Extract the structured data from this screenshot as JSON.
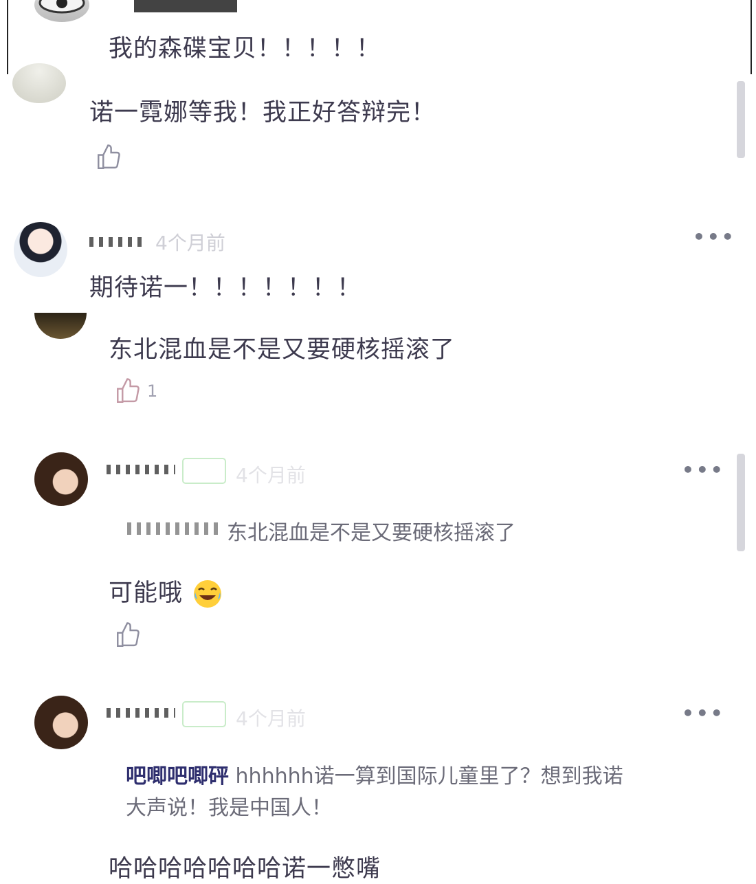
{
  "comments": [
    {
      "text": "我的森碟宝贝！！！！！"
    },
    {
      "text": "诺一霓娜等我！我正好答辩完！"
    },
    {
      "time": "4个月前",
      "text": "期待诺一！！！！！！！"
    },
    {
      "text": "东北混血是不是又要硬核摇滚了",
      "likes": "1"
    },
    {
      "time": "4个月前",
      "quote": "东北混血是不是又要硬核摇滚了",
      "text": "可能哦"
    },
    {
      "time": "4个月前",
      "quote_author": "吧唧吧唧砰",
      "quote_line1": "hhhhhh诺一算到国际儿童里了？想到我诺",
      "quote_line2": "大声说！我是中国人！",
      "text": "哈哈哈哈哈哈哈诺一憋嘴"
    }
  ],
  "icons": {
    "like": "thumbs-up-icon",
    "more": "more-dots-icon",
    "emoji": "laughing-tears-emoji"
  },
  "colors": {
    "text": "#3d3a4e",
    "meta": "#cfcfd6",
    "scrollbar": "#d6d6dc"
  }
}
